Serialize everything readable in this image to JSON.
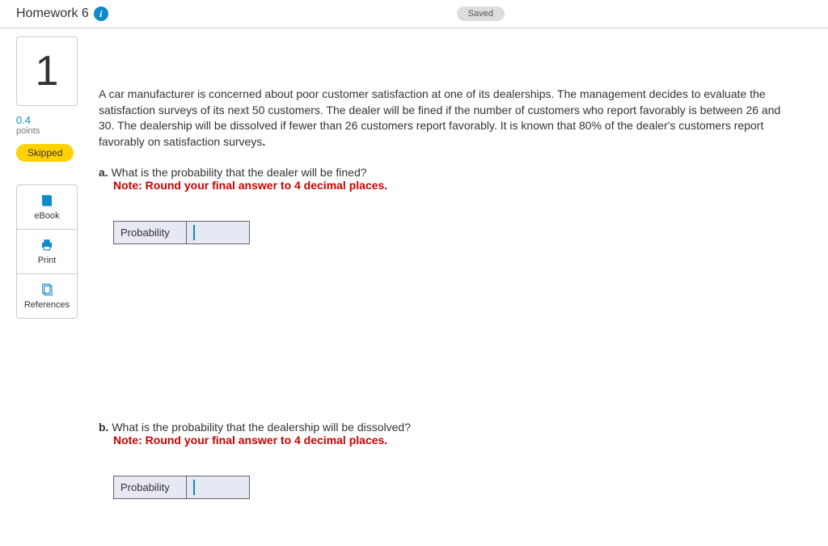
{
  "header": {
    "title": "Homework 6",
    "saved_label": "Saved"
  },
  "sidebar": {
    "question_number": "1",
    "points_value": "0.4",
    "points_label": "points",
    "status": "Skipped",
    "tools": {
      "ebook": "eBook",
      "print": "Print",
      "references": "References"
    }
  },
  "problem": {
    "intro": "A car manufacturer is concerned about poor customer satisfaction at one of its dealerships. The management decides to evaluate the satisfaction surveys of its next 50 customers. The dealer will be fined if the number of customers who report favorably is between 26 and 30. The dealership will be dissolved if fewer than 26 customers report favorably. It is known that 80% of the dealer's customers report favorably on satisfaction surveys",
    "parts": {
      "a": {
        "label": "a.",
        "question": " What is the probability that the dealer will be fined?",
        "note": "Note: Round your final answer to 4 decimal places.",
        "row_label": "Probability",
        "value": ""
      },
      "b": {
        "label": "b.",
        "question": " What is the probability that the dealership will be dissolved?",
        "note": "Note: Round your final answer to 4 decimal places.",
        "row_label": "Probability",
        "value": ""
      }
    }
  }
}
